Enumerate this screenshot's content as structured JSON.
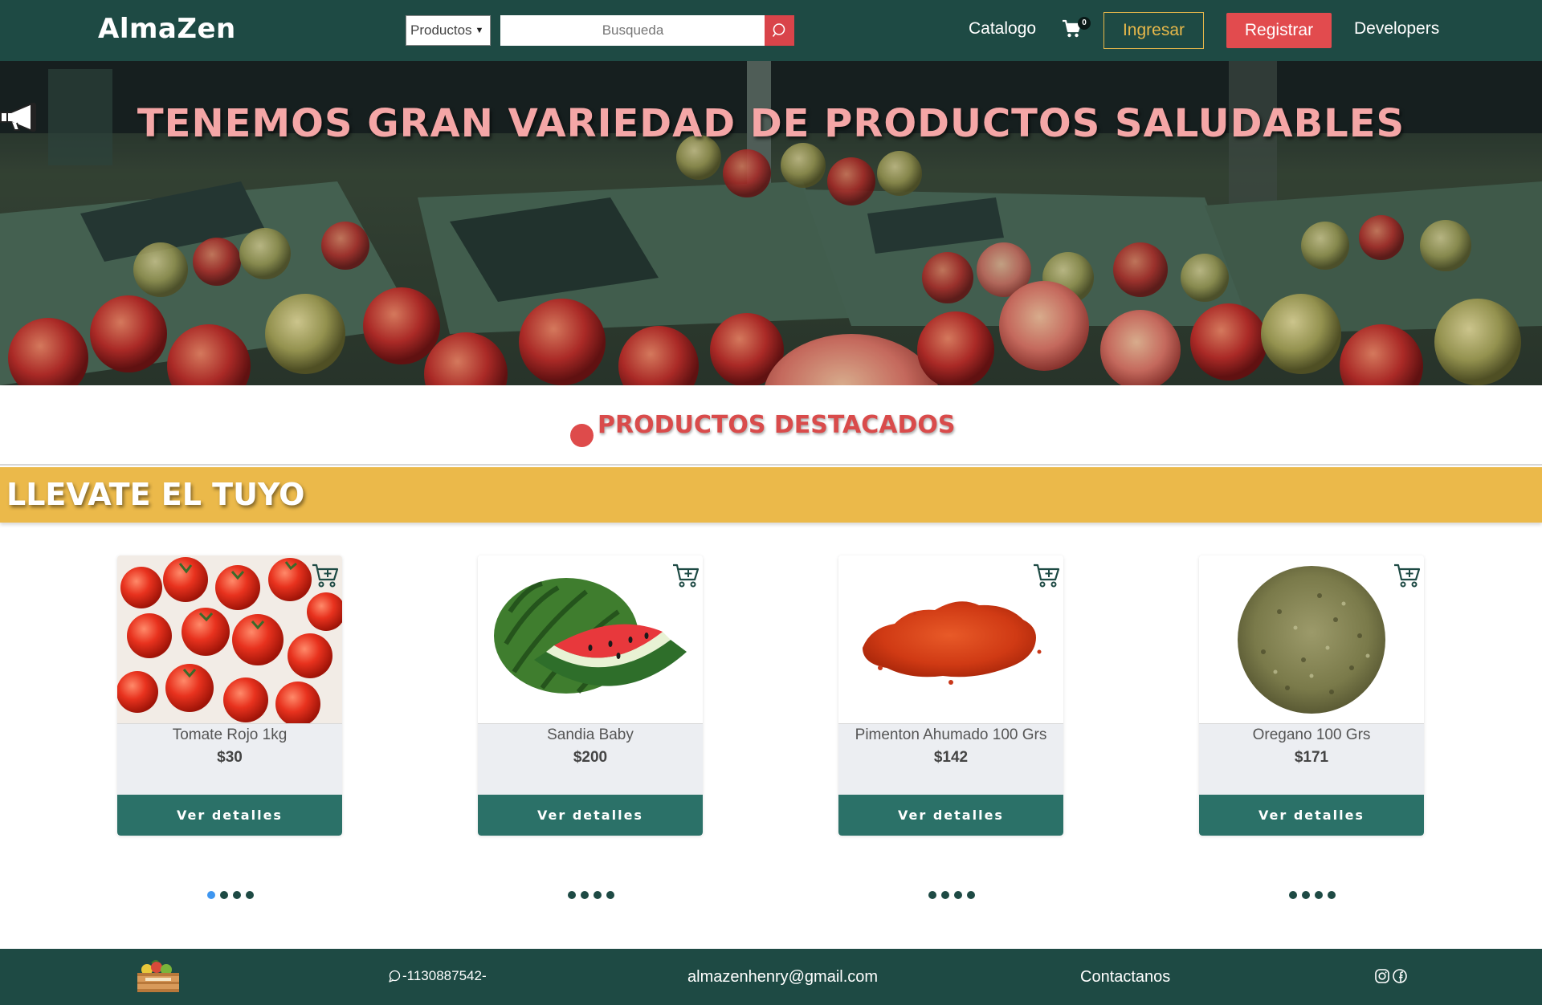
{
  "navbar": {
    "brand": "AlmaZen",
    "category_select": "Productos",
    "search_placeholder": "Busqueda",
    "catalog_link": "Catalogo",
    "cart_count": "0",
    "login_button": "Ingresar",
    "register_button": "Registrar",
    "developers_link": "Developers"
  },
  "hero": {
    "icon": "megaphone-icon",
    "title": "TENEMOS GRAN VARIEDAD DE PRODUCTOS SALUDABLES"
  },
  "featured": {
    "title": "PRODUCTOS DESTACADOS"
  },
  "banner": {
    "title": "LLEVATE EL TUYO"
  },
  "products": [
    {
      "name": "Tomate Rojo 1kg",
      "price": "$30",
      "button": "Ver detalles",
      "image": "tomatoes"
    },
    {
      "name": "Sandia Baby",
      "price": "$200",
      "button": "Ver detalles",
      "image": "watermelon"
    },
    {
      "name": "Pimenton Ahumado 100 Grs",
      "price": "$142",
      "button": "Ver detalles",
      "image": "paprika"
    },
    {
      "name": "Oregano 100 Grs",
      "price": "$171",
      "button": "Ver detalles",
      "image": "oregano"
    }
  ],
  "footer": {
    "phone": "-1130887542-",
    "email": "almazenhenry@gmail.com",
    "contact": "Contactanos"
  },
  "colors": {
    "navbar": "#1e4a44",
    "accent_red": "#e24b4e",
    "accent_yellow": "#ebb94a",
    "button_green": "#2b7168",
    "hero_text": "#f4a6a6"
  }
}
